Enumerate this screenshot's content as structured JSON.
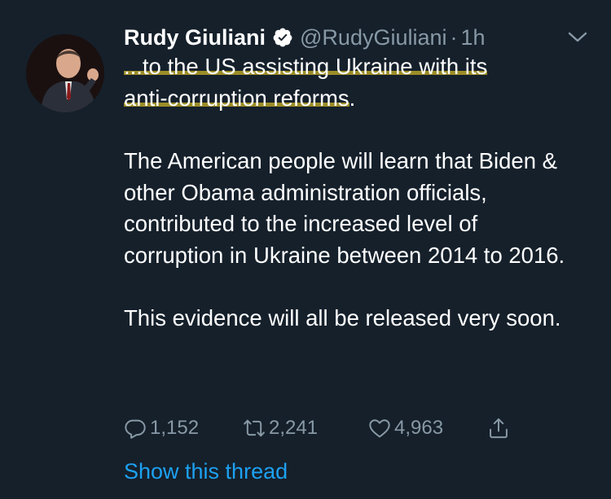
{
  "author": {
    "name": "Rudy Giuliani",
    "handle": "@RudyGiuliani",
    "separator": "·",
    "time": "1h"
  },
  "tweet": {
    "line1": "...to the US assisting Ukraine with its",
    "line2": "anti-corruption reforms",
    "line2_tail": ".",
    "paragraph2": "The American people will learn that Biden & other Obama administration officials, contributed to the increased level of corruption in Ukraine between 2014 to 2016.",
    "paragraph3": "This evidence will all be released very soon."
  },
  "actions": {
    "replies": "1,152",
    "retweets": "2,241",
    "likes": "4,963"
  },
  "thread_link": "Show this thread",
  "colors": {
    "background": "#15202b",
    "text": "#ffffff",
    "muted": "#8899a6",
    "link": "#1da1f2",
    "highlight": "#b4a028"
  },
  "icons": {
    "verified": "verified-badge-icon",
    "caret": "chevron-down-icon",
    "reply": "reply-icon",
    "retweet": "retweet-icon",
    "like": "heart-icon",
    "share": "share-icon"
  }
}
